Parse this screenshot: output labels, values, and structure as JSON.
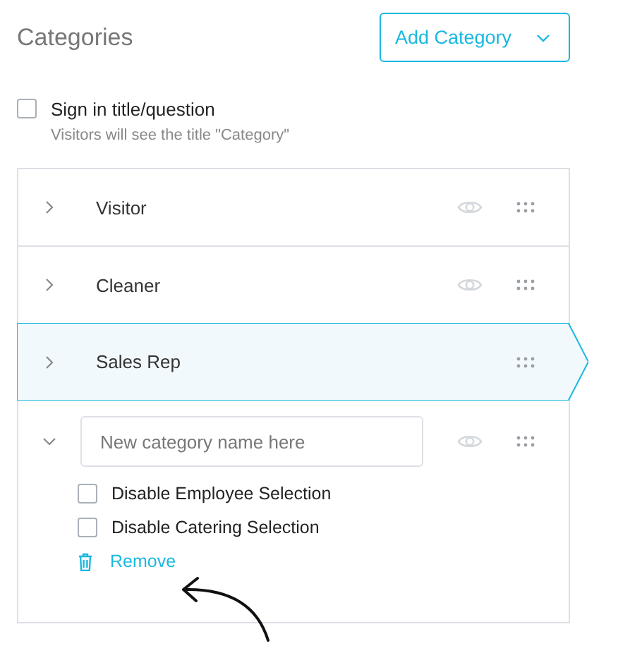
{
  "header": {
    "title": "Categories",
    "add_button": "Add Category"
  },
  "sign_in_option": {
    "label": "Sign in title/question",
    "hint": "Visitors will see the title \"Category\"",
    "checked": false
  },
  "categories": [
    {
      "name": "Visitor",
      "expanded": false,
      "selected": false,
      "eye": true
    },
    {
      "name": "Cleaner",
      "expanded": false,
      "selected": false,
      "eye": true
    },
    {
      "name": "Sales Rep",
      "expanded": false,
      "selected": true,
      "eye": false
    },
    {
      "placeholder": "New category name here",
      "expanded": true,
      "selected": false,
      "eye": true,
      "options": [
        {
          "label": "Disable Employee Selection",
          "checked": false
        },
        {
          "label": "Disable Catering Selection",
          "checked": false
        }
      ],
      "remove_label": "Remove"
    }
  ]
}
